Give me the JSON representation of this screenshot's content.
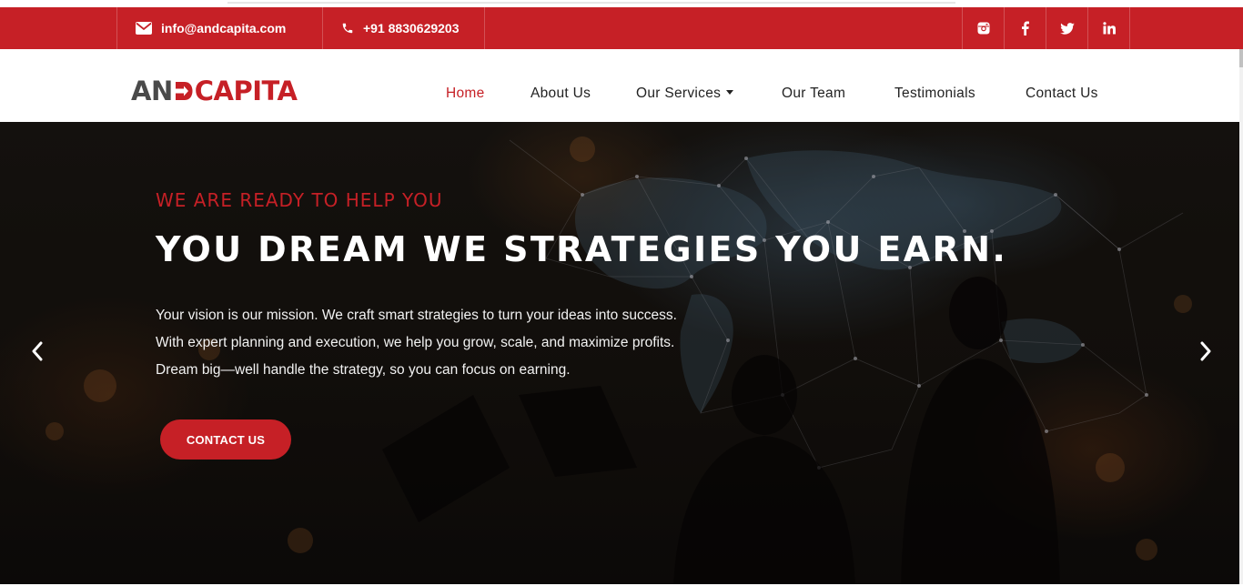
{
  "topbar": {
    "email": "info@andcapita.com",
    "phone": "+91 8830629203",
    "email_icon": "envelope-icon",
    "phone_icon": "phone-icon",
    "social": [
      "instagram-icon",
      "facebook-icon",
      "twitter-icon",
      "linkedin-icon"
    ]
  },
  "logo": {
    "part1": "AN",
    "part2": "CAPITA"
  },
  "nav": {
    "home": "Home",
    "about": "About Us",
    "services": "Our Services",
    "team": "Our Team",
    "testimonials": "Testimonials",
    "contact": "Contact Us"
  },
  "hero": {
    "subtitle": "WE ARE READY TO HELP YOU",
    "title": "YOU DREAM WE STRATEGIES YOU EARN.",
    "lines": [
      "Your vision is our mission. We craft smart strategies to turn your ideas into success.",
      "With expert planning and execution, we help you grow, scale, and maximize profits.",
      "Dream big—well handle the strategy, so you can focus on earning."
    ],
    "button": "CONTACT US"
  },
  "colors": {
    "brand_red": "#c62026",
    "logo_gray": "#4a4a4a",
    "hero_bg": "#17130f"
  }
}
